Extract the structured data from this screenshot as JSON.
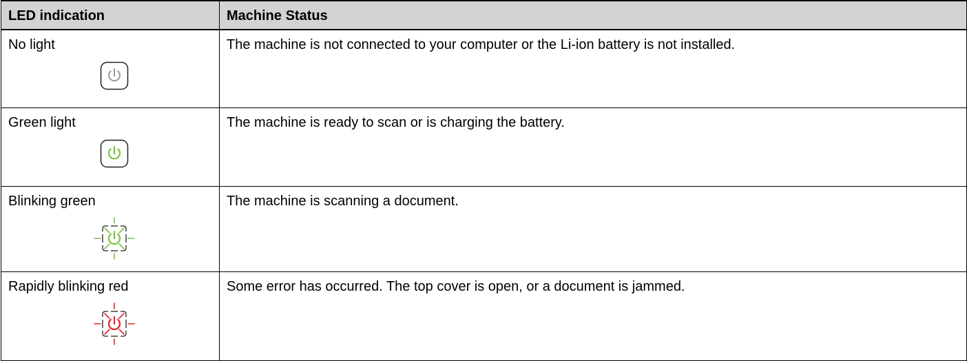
{
  "table": {
    "headers": [
      "LED indication",
      "Machine Status"
    ],
    "rows": [
      {
        "led": "No light",
        "status": "The machine is not connected to your computer or the Li-ion battery is not installed.",
        "icon": "power-led-off-icon",
        "color": "#9a9a9a"
      },
      {
        "led": "Green light",
        "status": "The machine is ready to scan or is charging the battery.",
        "icon": "power-led-green-icon",
        "color": "#7ac143"
      },
      {
        "led": "Blinking green",
        "status": "The machine is scanning a document.",
        "icon": "power-led-blinking-green-icon",
        "color": "#7ac143"
      },
      {
        "led": "Rapidly blinking red",
        "status": "Some error has occurred. The top cover is open, or a document is jammed.",
        "icon": "power-led-blinking-red-icon",
        "color": "#e8212e"
      }
    ]
  },
  "colors": {
    "header_background": "#d3d3d3",
    "border": "#000000",
    "led_off": "#9a9a9a",
    "led_green": "#7ac143",
    "led_red": "#e8212e"
  }
}
